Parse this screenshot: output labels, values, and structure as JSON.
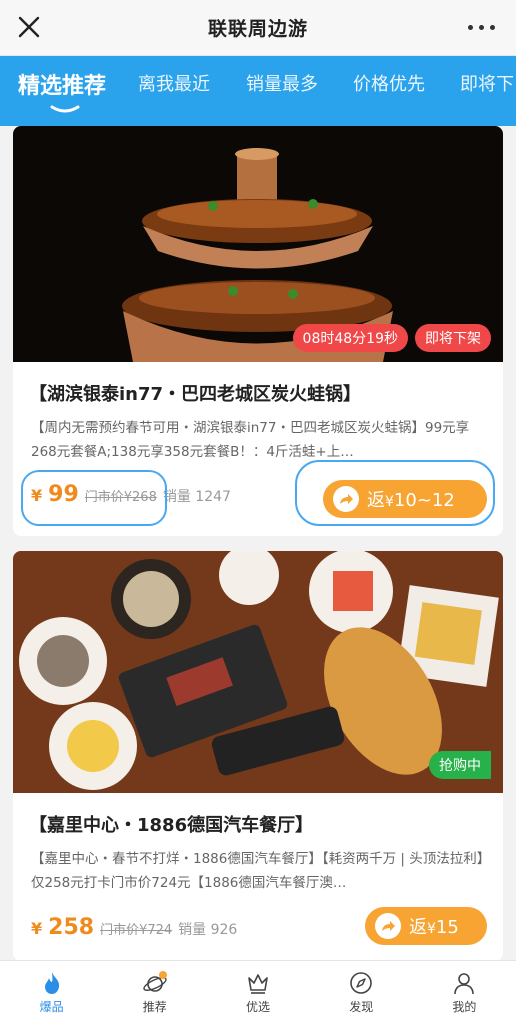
{
  "header": {
    "title": "联联周边游"
  },
  "tabs": [
    {
      "label": "精选推荐",
      "active": true
    },
    {
      "label": "离我最近",
      "active": false
    },
    {
      "label": "销量最多",
      "active": false
    },
    {
      "label": "价格优先",
      "active": false
    },
    {
      "label": "即将下",
      "active": false
    }
  ],
  "cards": [
    {
      "countdown": "08时48分19秒",
      "tag": "即将下架",
      "name": "【湖滨银泰in77・巴四老城区炭火蛙锅】",
      "desc": "【周内无需预约春节可用・湖滨银泰in77・巴四老城区炭火蛙锅】99元享268元套餐A;138元享358元套餐B！：4斤活蛙+上…",
      "currency": "¥",
      "price": "99",
      "orig_price": "门市价¥268",
      "sales": "销量 1247",
      "rebate_label": "返",
      "rebate_currency": "¥",
      "rebate_value": "10~12"
    },
    {
      "tag": "抢购中",
      "name": "【嘉里中心・1886德国汽车餐厅】",
      "desc": "【嘉里中心・春节不打烊・1886德国汽车餐厅】【耗资两千万 | 头顶法拉利】仅258元打卡门市价724元【1886德国汽车餐厅澳…",
      "currency": "¥",
      "price": "258",
      "orig_price": "门市价¥724",
      "sales": "销量 926",
      "rebate_label": "返",
      "rebate_currency": "¥",
      "rebate_value": "15"
    }
  ],
  "bottom_nav": [
    {
      "label": "爆品",
      "icon": "flame-icon",
      "active": true
    },
    {
      "label": "推荐",
      "icon": "planet-icon",
      "active": false
    },
    {
      "label": "优选",
      "icon": "crown-icon",
      "active": false
    },
    {
      "label": "发现",
      "icon": "compass-icon",
      "active": false
    },
    {
      "label": "我的",
      "icon": "user-icon",
      "active": false
    }
  ],
  "colors": {
    "accent": "#2ba3ec",
    "price": "#f08a1c",
    "rebate": "#f7a432",
    "tag_red": "#f04848",
    "tag_green": "#27b14a"
  }
}
